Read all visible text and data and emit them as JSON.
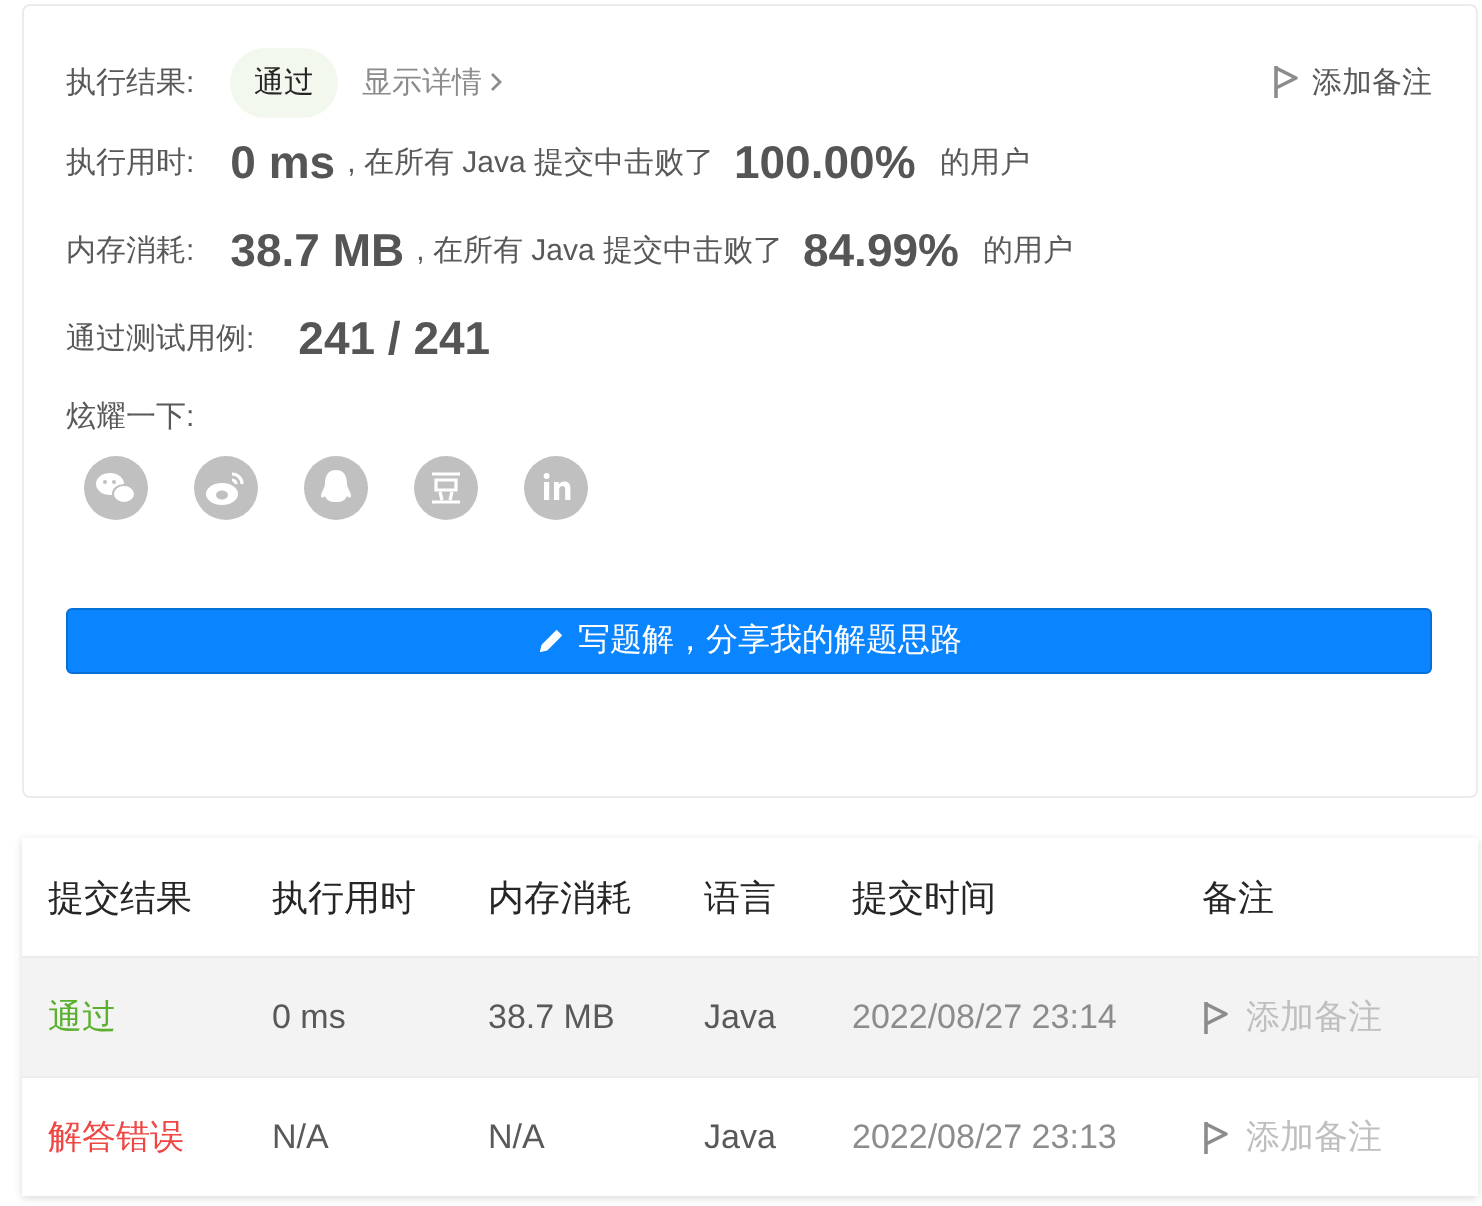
{
  "result": {
    "label": "执行结果:",
    "status": "通过",
    "details_link": "显示详情",
    "note_button": "添加备注"
  },
  "stats": [
    {
      "label": "执行用时:",
      "value": "0 ms",
      "text": ", 在所有 Java 提交中击败了",
      "percent": "100.00%",
      "suffix": "的用户"
    },
    {
      "label": "内存消耗:",
      "value": "38.7 MB",
      "text": ", 在所有 Java 提交中击败了",
      "percent": "84.99%",
      "suffix": "的用户"
    }
  ],
  "tests": {
    "label": "通过测试用例:",
    "value": "241 / 241"
  },
  "share": {
    "label": "炫耀一下:",
    "icons": [
      {
        "kind": "wechat"
      },
      {
        "kind": "weibo"
      },
      {
        "kind": "qq"
      },
      {
        "kind": "douban"
      },
      {
        "kind": "linkedin"
      }
    ]
  },
  "solution_button": "写题解，分享我的解题思路",
  "submissions": {
    "columns": [
      "提交结果",
      "执行用时",
      "内存消耗",
      "语言",
      "提交时间",
      "备注"
    ],
    "rows": [
      {
        "result": "通过",
        "kind": "accepted",
        "runtime": "0 ms",
        "memory": "38.7 MB",
        "language": "Java",
        "time": "2022/08/27 23:14",
        "note": "添加备注",
        "highlighted": true
      },
      {
        "result": "解答错误",
        "kind": "wrong_answer",
        "runtime": "N/A",
        "memory": "N/A",
        "language": "Java",
        "time": "2022/08/27 23:13",
        "note": "添加备注",
        "highlighted": false
      }
    ]
  }
}
